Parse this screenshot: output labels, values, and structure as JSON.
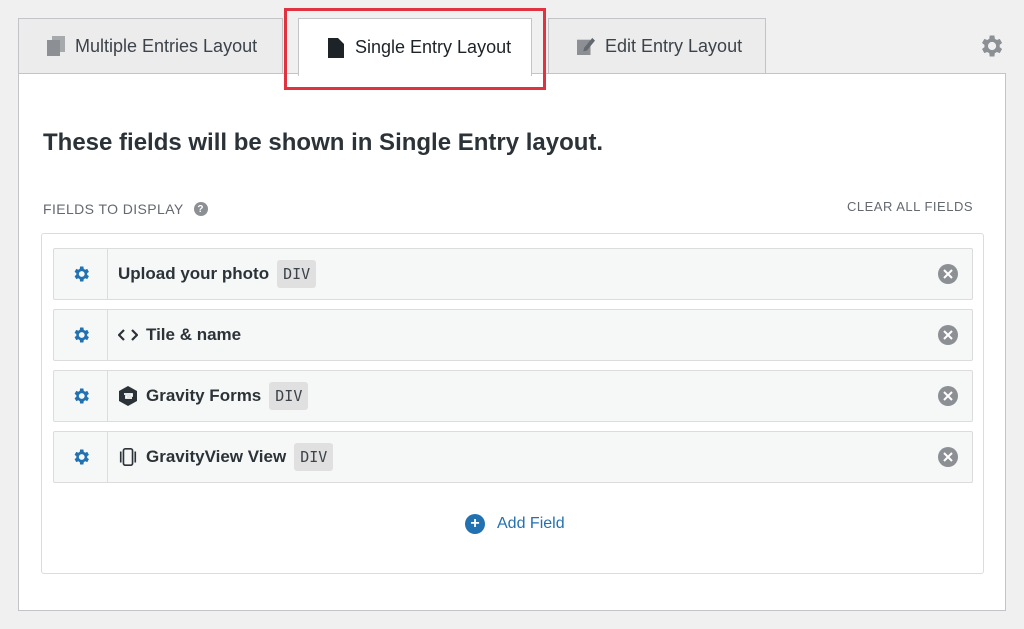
{
  "tabs": [
    {
      "label": "Multiple Entries Layout",
      "icon": "copy-icon"
    },
    {
      "label": "Single Entry Layout",
      "icon": "document-icon",
      "active": true
    },
    {
      "label": "Edit Entry Layout",
      "icon": "edit-icon"
    }
  ],
  "settings_icon": "gear-icon",
  "panel": {
    "heading": "These fields will be shown in Single Entry layout.",
    "fields_label": "FIELDS TO DISPLAY",
    "help": "?",
    "clear_all": "CLEAR ALL FIELDS"
  },
  "fields": [
    {
      "label": "Upload your photo",
      "badge": "DIV",
      "icon": ""
    },
    {
      "label": "Tile & name",
      "badge": "",
      "icon": "code-icon"
    },
    {
      "label": "Gravity Forms",
      "badge": "DIV",
      "icon": "gravity-forms-icon"
    },
    {
      "label": "GravityView View",
      "badge": "DIV",
      "icon": "gravityview-icon"
    }
  ],
  "add_field": "Add Field",
  "colors": {
    "accent": "#2271b1",
    "highlight": "#e0333f",
    "muted": "#8c8f94"
  }
}
